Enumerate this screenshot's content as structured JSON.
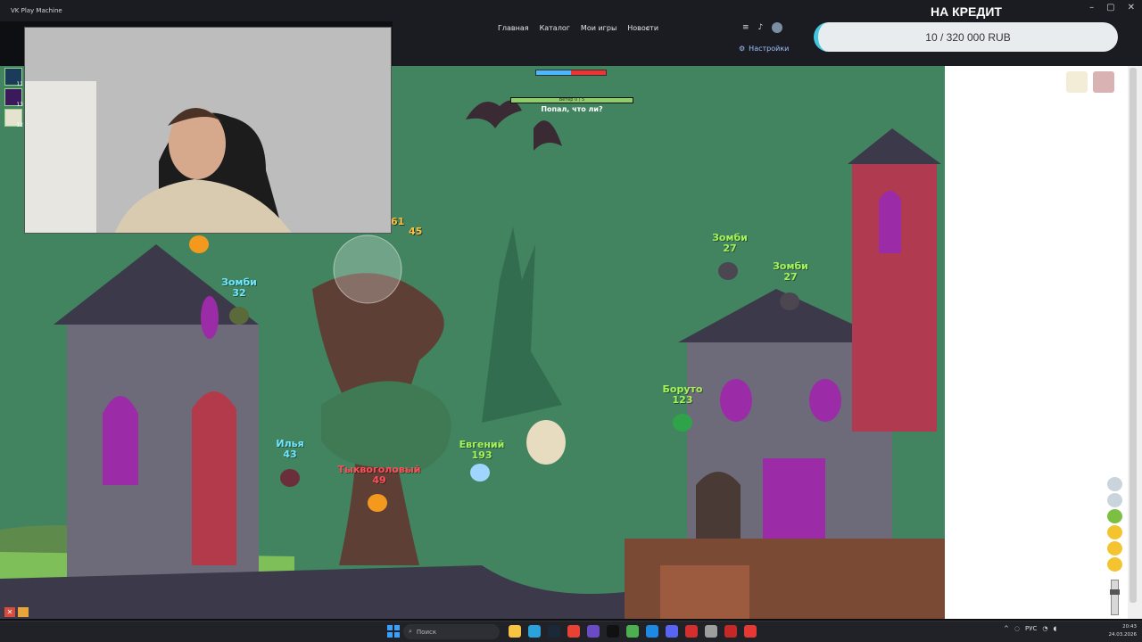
{
  "window": {
    "title": "VK Play Machine",
    "controls": [
      "–",
      "▢",
      "✕"
    ]
  },
  "nav": {
    "links": [
      "Главная",
      "Каталог",
      "Мои игры",
      "Новости"
    ],
    "search_icon": "search-icon",
    "settings_label": "Настройки"
  },
  "credit": {
    "title": "НА КРЕДИТ",
    "progress_text": "10 / 320 000 RUB",
    "current": 10,
    "goal": 320000
  },
  "minipanel": {
    "tiles": [
      "11",
      "13",
      "12"
    ]
  },
  "hud": {
    "turn_label": "Ветер 0 / 5",
    "turn_message": "Попал, что ли?"
  },
  "worms": [
    {
      "name": "Зомби",
      "hp": "32",
      "color": "cyan"
    },
    {
      "name": "Зомби",
      "hp": "27",
      "color": "green"
    },
    {
      "name": "Зомби",
      "hp": "27",
      "color": "green"
    },
    {
      "name": "Боруто",
      "hp": "123",
      "color": "green"
    },
    {
      "name": "Илья",
      "hp": "43",
      "color": "cyan"
    },
    {
      "name": "Евгений",
      "hp": "193",
      "color": "green"
    },
    {
      "name": "Тыквоголовый",
      "hp": "49",
      "color": "red"
    }
  ],
  "damage": [
    "61",
    "45"
  ],
  "taskbar": {
    "search_placeholder": "Поиск",
    "lang": "РУС",
    "time": "20:43",
    "date": "24.03.2026"
  },
  "colors": {
    "game_bg": "#428460",
    "accent": "#43c6e0",
    "hp_green": "#a6f25a",
    "hp_cyan": "#6ee6ff",
    "hp_red": "#ff4d5a"
  }
}
